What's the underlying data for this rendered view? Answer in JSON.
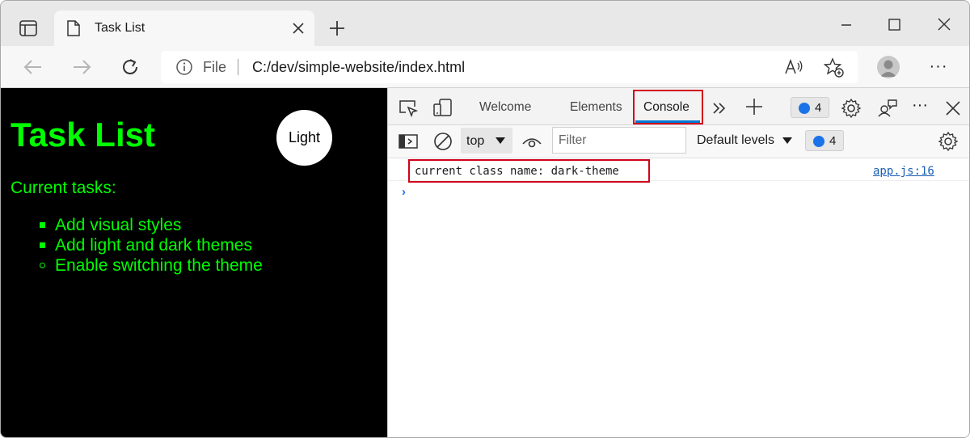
{
  "browser": {
    "tab": {
      "title": "Task List"
    },
    "address": {
      "scheme_label": "File",
      "url": "C:/dev/simple-website/index.html"
    }
  },
  "page": {
    "title": "Task List",
    "theme_button_label": "Light",
    "tasks_heading": "Current tasks:",
    "tasks": [
      {
        "label": "Add visual styles",
        "done": true
      },
      {
        "label": "Add light and dark themes",
        "done": true
      },
      {
        "label": "Enable switching the theme",
        "done": false
      }
    ],
    "background_color": "#000000",
    "text_color": "#00ff00"
  },
  "devtools": {
    "tabs": [
      {
        "label": "Welcome",
        "active": false
      },
      {
        "label": "Elements",
        "active": false
      },
      {
        "label": "Console",
        "active": true
      }
    ],
    "issues_count": "4",
    "toolbar": {
      "context": "top",
      "filter_placeholder": "Filter",
      "levels_label": "Default levels",
      "messages_count": "4"
    },
    "console": {
      "messages": [
        {
          "text": "current class name: dark-theme",
          "source": "app.js:16"
        }
      ],
      "prompt_glyph": "›"
    },
    "highlight_color": "#d0021b",
    "accent_color": "#0078d4"
  }
}
